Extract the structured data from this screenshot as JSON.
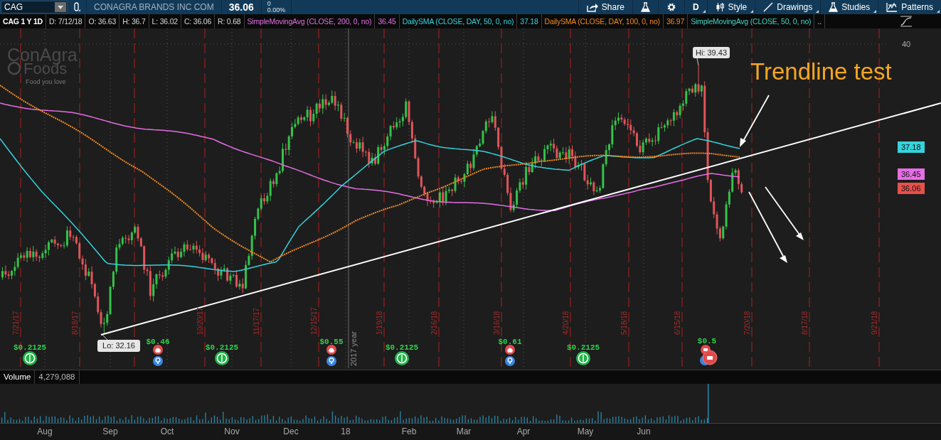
{
  "symbol_bar": {
    "symbol": "CAG",
    "company": "CONAGRA BRANDS INC COM",
    "last": "36.06",
    "change": "0",
    "change_pct": "0.00%"
  },
  "toolbar": [
    "Share",
    "D",
    "Style",
    "Drawings",
    "Studies",
    "Patterns"
  ],
  "header": {
    "title": "CAG 1 Y 1D",
    "fields": [
      "D: 7/12/18",
      "O: 36.63",
      "H: 36.7",
      "L: 36.02",
      "C: 36.06",
      "R: 0.68"
    ],
    "more": ".."
  },
  "studies": [
    {
      "name": "SimpleMovingAvg (CLOSE, 200, 0, no)",
      "value": "36.45",
      "color": "#e46ee4"
    },
    {
      "name": "DailySMA (CLOSE, DAY, 50, 0, no)",
      "value": "37.18",
      "color": "#35d3dc"
    },
    {
      "name": "DailySMA (CLOSE, DAY, 100, 0, no)",
      "value": "36.97",
      "color": "#f08a24"
    },
    {
      "name": "SimpleMovingAvg (CLOSE, 50, 0, no)",
      "color": "#3ed6c6"
    }
  ],
  "chart": {
    "logo": [
      "ConAgra",
      "Foods",
      "Food you love"
    ],
    "axis_label": "40",
    "high": "Hi: 39.43",
    "low": "Lo: 32.16",
    "annotation": "Trendline test",
    "year_marker": "2017 year",
    "price_badges": [
      {
        "text": "37.18",
        "color": "#35d3dc"
      },
      {
        "text": "36.45",
        "color": "#e46ee4"
      },
      {
        "text": "36.06",
        "color": "#e8504a"
      }
    ],
    "grid_dates": [
      "7/21/17",
      "8/18/17",
      "10/20/17",
      "11/17/17",
      "12/15/17",
      "1/19/18",
      "2/16/18",
      "3/16/18",
      "4/20/18",
      "5/18/18",
      "6/15/18",
      "7/20/18",
      "8/17/18",
      "9/21/18"
    ],
    "events": [
      {
        "kind": "dividend",
        "amount": "$0.2125"
      },
      {
        "kind": "earnings",
        "amount": "$0.46"
      },
      {
        "kind": "dividend",
        "amount": "$0.2125"
      },
      {
        "kind": "earnings",
        "amount": "$0.55"
      },
      {
        "kind": "dividend",
        "amount": "$0.2125"
      },
      {
        "kind": "earnings",
        "amount": "$0.61"
      },
      {
        "kind": "dividend",
        "amount": "$0.2125"
      },
      {
        "kind": "earnings_cluster",
        "amount": "$0.5"
      }
    ]
  },
  "volume": {
    "label": "Volume",
    "value": "4,279,088"
  },
  "months": [
    "Aug",
    "Sep",
    "Oct",
    "Nov",
    "Dec",
    "18",
    "Feb",
    "Mar",
    "Apr",
    "May",
    "Jun"
  ]
}
